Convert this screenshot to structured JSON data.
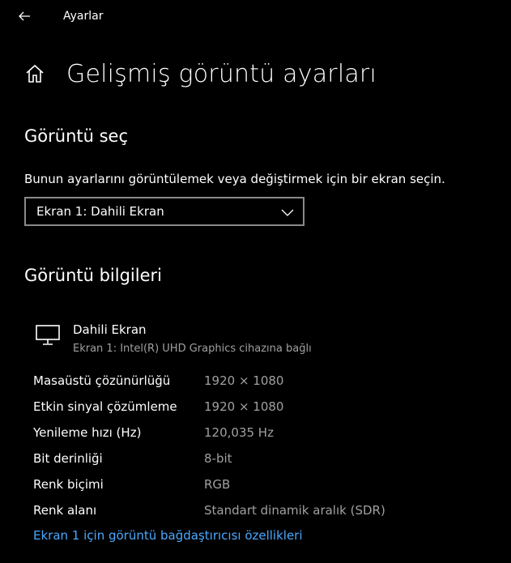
{
  "app": {
    "title": "Ayarlar"
  },
  "header": {
    "title": "Gelişmiş görüntü ayarları"
  },
  "select_display": {
    "heading": "Görüntü seç",
    "description": "Bunun ayarlarını görüntülemek veya değiştirmek için bir ekran seçin.",
    "dropdown_value": "Ekran 1: Dahili Ekran"
  },
  "display_info": {
    "heading": "Görüntü bilgileri",
    "display_name": "Dahili Ekran",
    "display_sub": "Ekran 1: Intel(R) UHD Graphics cihazına bağlı",
    "rows": [
      {
        "label": "Masaüstü çözünürlüğü",
        "value": "1920 × 1080"
      },
      {
        "label": "Etkin sinyal çözümleme",
        "value": "1920 × 1080"
      },
      {
        "label": "Yenileme hızı (Hz)",
        "value": "120,035 Hz"
      },
      {
        "label": "Bit derinliği",
        "value": "8-bit"
      },
      {
        "label": "Renk biçimi",
        "value": "RGB"
      },
      {
        "label": "Renk alanı",
        "value": "Standart dinamik aralık (SDR)"
      }
    ],
    "adapter_link": "Ekran 1 için görüntü bağdaştırıcısı özellikleri"
  },
  "icons": {
    "back": "back-arrow-icon",
    "home": "home-icon",
    "chevron": "chevron-down-icon",
    "monitor": "monitor-icon"
  },
  "colors": {
    "background": "#000000",
    "text": "#ffffff",
    "secondary_text": "#a0a0a0",
    "link": "#4aa8ff",
    "dropdown_border": "#8a8a8a"
  }
}
